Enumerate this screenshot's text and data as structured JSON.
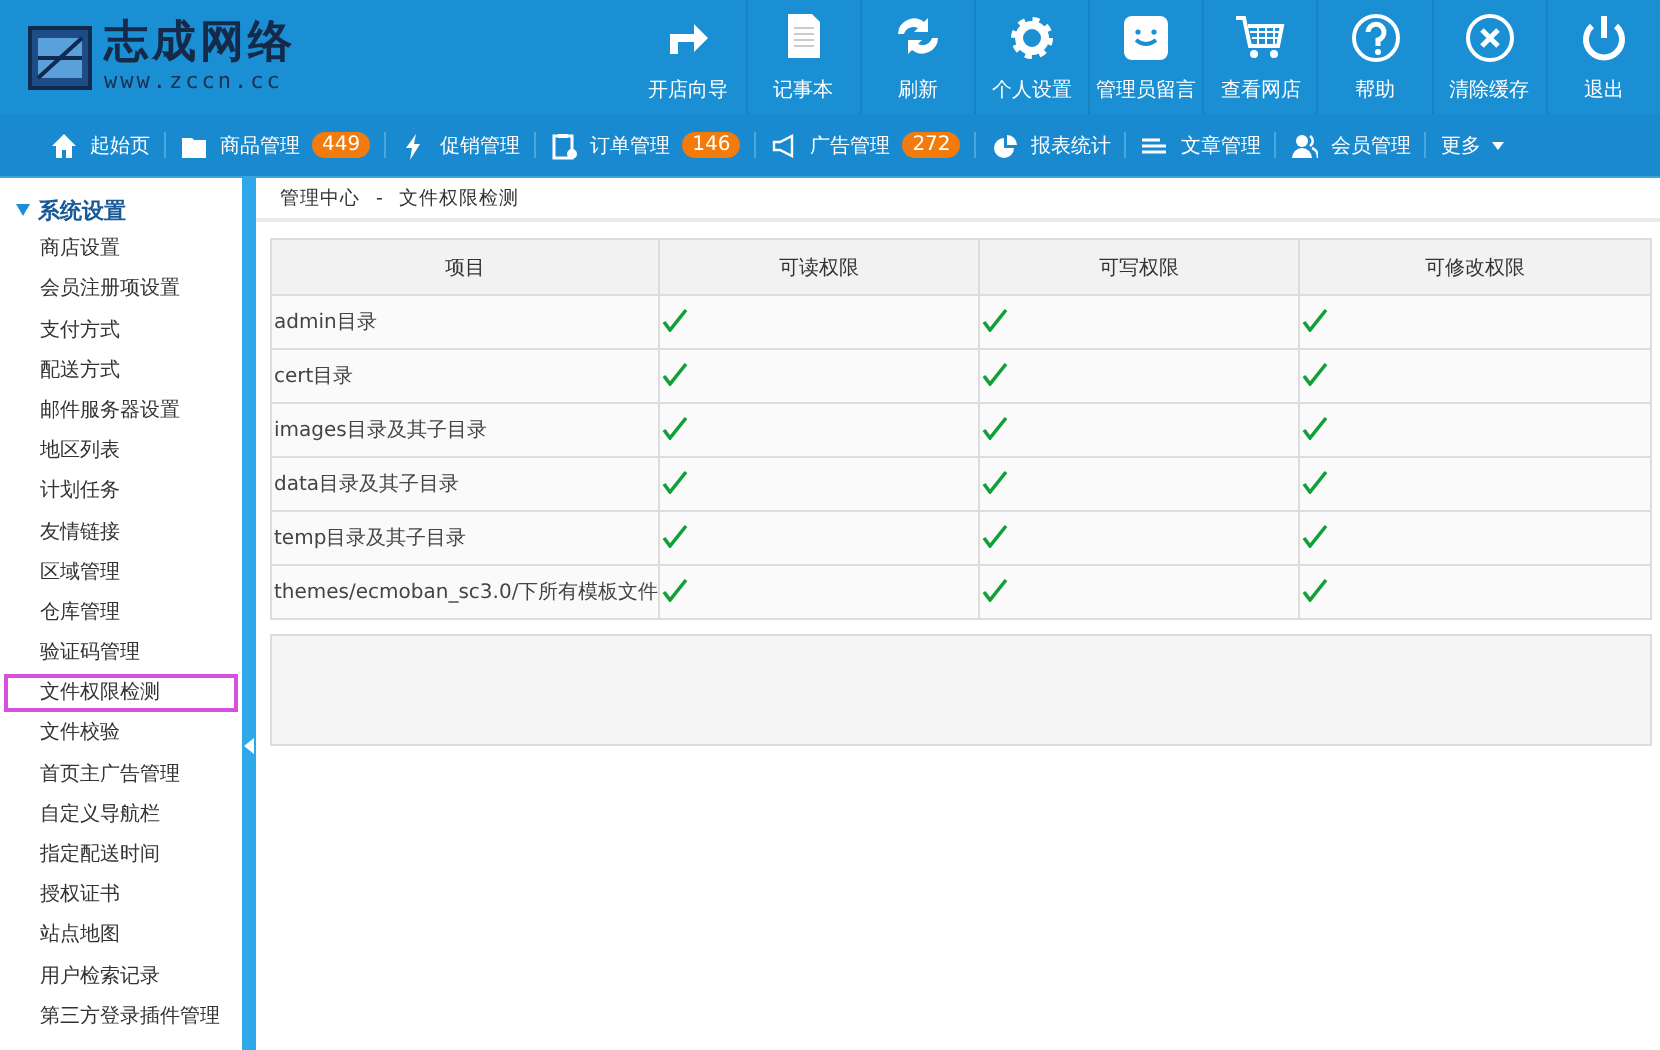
{
  "logo": {
    "name": "志成网络",
    "url": "www.zccn.cc"
  },
  "toolbar": [
    "开店向导",
    "记事本",
    "刷新",
    "个人设置",
    "管理员留言",
    "查看网店",
    "帮助",
    "清除缓存",
    "退出"
  ],
  "nav": [
    {
      "label": "起始页"
    },
    {
      "label": "商品管理",
      "badge": "449"
    },
    {
      "label": "促销管理"
    },
    {
      "label": "订单管理",
      "badge": "146"
    },
    {
      "label": "广告管理",
      "badge": "272"
    },
    {
      "label": "报表统计"
    },
    {
      "label": "文章管理"
    },
    {
      "label": "会员管理"
    },
    {
      "label": "更多"
    }
  ],
  "sidebar": {
    "section": "系统设置",
    "expanded": true,
    "items": [
      {
        "label": "商店设置",
        "selected": false
      },
      {
        "label": "会员注册项设置",
        "selected": false
      },
      {
        "label": "支付方式",
        "selected": false
      },
      {
        "label": "配送方式",
        "selected": false
      },
      {
        "label": "邮件服务器设置",
        "selected": false
      },
      {
        "label": "地区列表",
        "selected": false
      },
      {
        "label": "计划任务",
        "selected": false
      },
      {
        "label": "友情链接",
        "selected": false
      },
      {
        "label": "区域管理",
        "selected": false
      },
      {
        "label": "仓库管理",
        "selected": false
      },
      {
        "label": "验证码管理",
        "selected": false
      },
      {
        "label": "文件权限检测",
        "selected": true
      },
      {
        "label": "文件校验",
        "selected": false
      },
      {
        "label": "首页主广告管理",
        "selected": false
      },
      {
        "label": "自定义导航栏",
        "selected": false
      },
      {
        "label": "指定配送时间",
        "selected": false
      },
      {
        "label": "授权证书",
        "selected": false
      },
      {
        "label": "站点地图",
        "selected": false
      },
      {
        "label": "用户检索记录",
        "selected": false
      },
      {
        "label": "第三方登录插件管理",
        "selected": false
      }
    ]
  },
  "breadcrumb": {
    "home": "管理中心",
    "separator": "-",
    "current": "文件权限检测"
  },
  "table": {
    "columns": [
      "项目",
      "可读权限",
      "可写权限",
      "可修改权限"
    ],
    "rows": [
      {
        "item": "admin目录",
        "readable": true,
        "writable": true,
        "modifiable": true
      },
      {
        "item": "cert目录",
        "readable": true,
        "writable": true,
        "modifiable": true
      },
      {
        "item": "images目录及其子目录",
        "readable": true,
        "writable": true,
        "modifiable": true
      },
      {
        "item": "data目录及其子目录",
        "readable": true,
        "writable": true,
        "modifiable": true
      },
      {
        "item": "temp目录及其子目录",
        "readable": true,
        "writable": true,
        "modifiable": true
      },
      {
        "item": "themes/ecmoban_sc3.0/下所有模板文件",
        "readable": true,
        "writable": true,
        "modifiable": true
      }
    ]
  }
}
